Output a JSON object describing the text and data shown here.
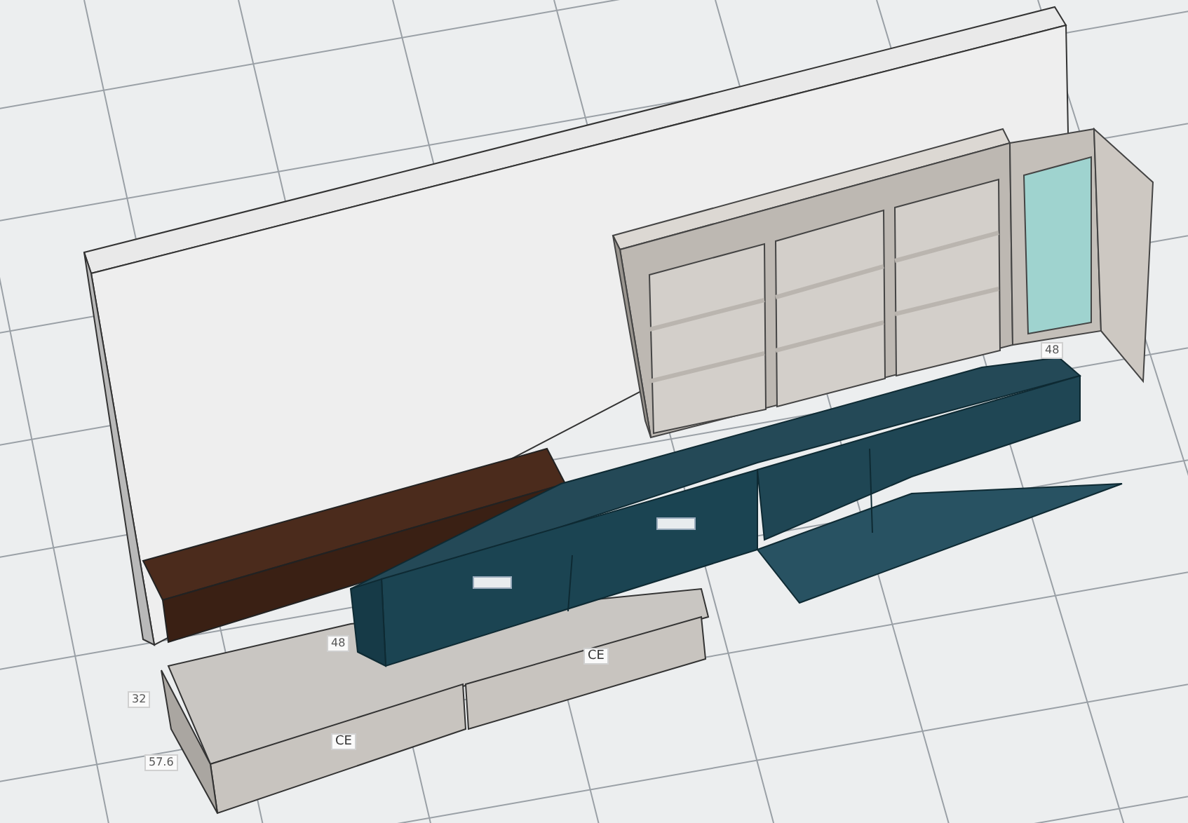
{
  "scene": {
    "labels": [
      {
        "kind": "dimension",
        "text": "48"
      },
      {
        "kind": "dimension",
        "text": "48"
      },
      {
        "kind": "dimension",
        "text": "32"
      },
      {
        "kind": "dimension",
        "text": "57.6"
      },
      {
        "kind": "tag",
        "text": "CE"
      },
      {
        "kind": "tag",
        "text": "CE"
      }
    ],
    "logo_plates": [
      {
        "kind": "plate"
      },
      {
        "kind": "plate"
      }
    ]
  }
}
